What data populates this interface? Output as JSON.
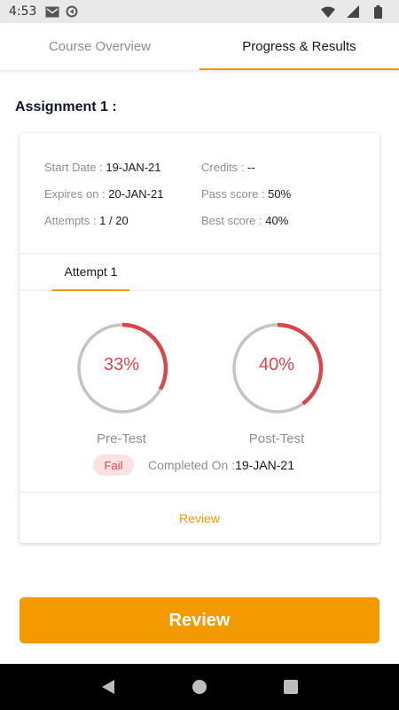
{
  "status_bar": {
    "time": "4:53",
    "left_icons": [
      "gmail-icon",
      "sync-icon"
    ],
    "right_icons": [
      "wifi-icon",
      "signal-icon",
      "battery-icon"
    ]
  },
  "tabs": [
    {
      "label": "Course Overview",
      "active": false
    },
    {
      "label": "Progress & Results",
      "active": true
    }
  ],
  "section_title": "Assignment 1 :",
  "card": {
    "start_date_label": "Start Date :",
    "start_date": "19-JAN-21",
    "expires_label": "Expires on :",
    "expires": "20-JAN-21",
    "attempts_label": "Attempts :",
    "attempts": "1 / 20",
    "credits_label": "Credits :",
    "credits": "--",
    "pass_score_label": "Pass score :",
    "pass_score": "50%",
    "best_score_label": "Best score :",
    "best_score": "40%",
    "attempt_tab": "Attempt 1",
    "pre_test": {
      "label": "Pre-Test",
      "percent_text": "33%",
      "value": 0.33
    },
    "post_test": {
      "label": "Post-Test",
      "percent_text": "40%",
      "value": 0.4
    },
    "status_badge": "Fail",
    "completed_label": "Completed On :",
    "completed_date": "19-JAN-21",
    "review_link": "Review"
  },
  "review_button": "Review",
  "colors": {
    "accent": "#f39a00",
    "fail_red": "#d9474c",
    "ring_track": "#c4c4c4"
  },
  "nav": [
    "back-icon",
    "home-icon",
    "recents-icon"
  ]
}
